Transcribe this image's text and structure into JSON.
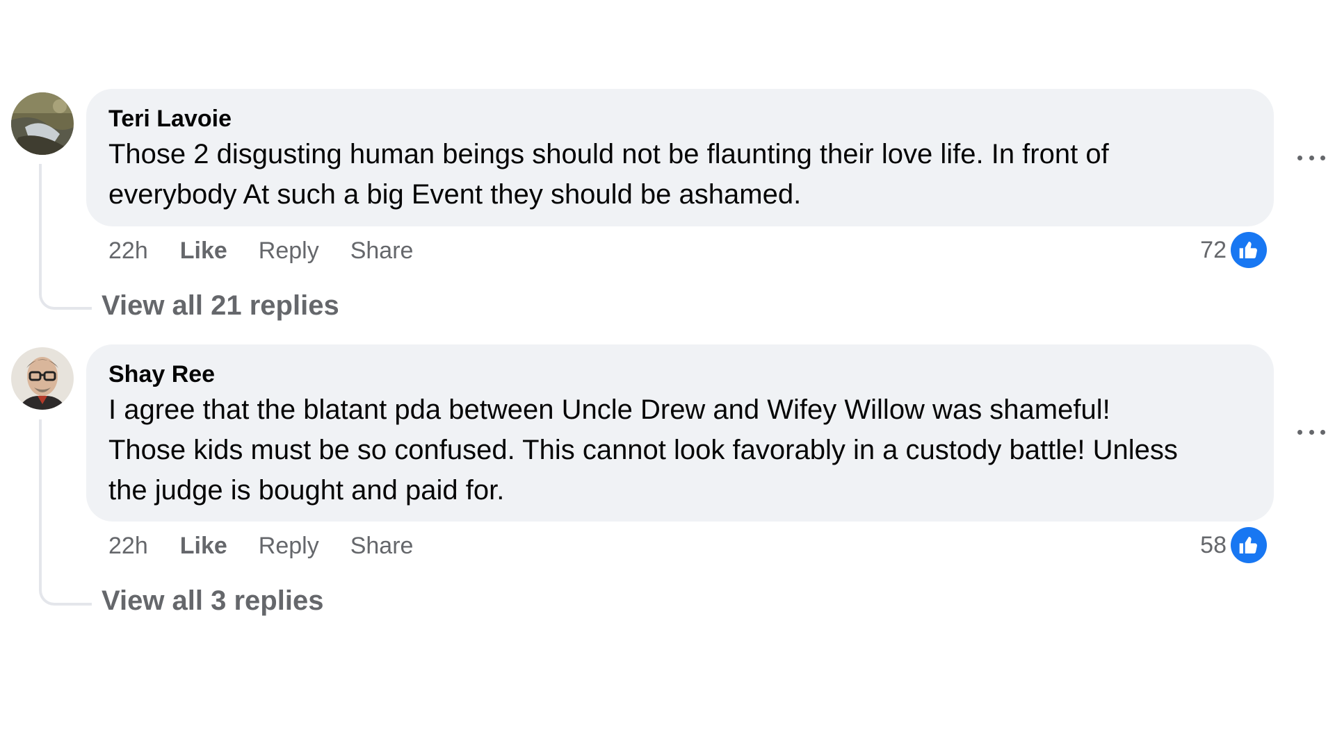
{
  "comments": [
    {
      "author": "Teri Lavoie",
      "text_line1": "Those 2 disgusting human beings should not be flaunting their love life. In front of",
      "text_line2": "everybody At such a big Event they should be ashamed.",
      "text_line3": "",
      "time": "22h",
      "like_label": "Like",
      "reply_label": "Reply",
      "share_label": "Share",
      "reaction_count": "72",
      "reaction_icon": "thumbs-up-icon",
      "view_replies": "View all 21 replies"
    },
    {
      "author": "Shay Ree",
      "text_line1": "I agree that the blatant pda between Uncle Drew and Wifey Willow was shameful!",
      "text_line2": "Those kids must be so confused. This cannot look favorably in a custody battle! Unless",
      "text_line3": "the judge is bought and paid for.",
      "time": "22h",
      "like_label": "Like",
      "reply_label": "Reply",
      "share_label": "Share",
      "reaction_count": "58",
      "reaction_icon": "thumbs-up-icon",
      "view_replies": "View all 3 replies"
    }
  ],
  "colors": {
    "bubble": "#f0f2f5",
    "secondary_text": "#65676b",
    "like_blue": "#1877f2",
    "thread_line": "#e4e6eb"
  }
}
